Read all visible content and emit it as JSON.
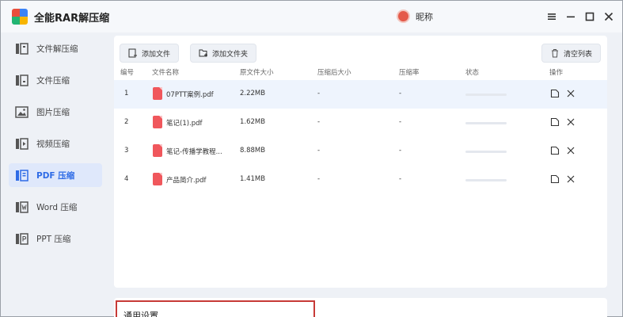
{
  "app": {
    "title": "全能RAR解压缩"
  },
  "user": {
    "name": "昵称"
  },
  "sidebar": {
    "items": [
      {
        "label": "文件解压缩",
        "icon": "archive-extract-icon"
      },
      {
        "label": "文件压缩",
        "icon": "archive-compress-icon"
      },
      {
        "label": "图片压缩",
        "icon": "image-icon"
      },
      {
        "label": "视频压缩",
        "icon": "video-icon"
      },
      {
        "label": "PDF 压缩",
        "icon": "pdf-icon",
        "active": true
      },
      {
        "label": "Word 压缩",
        "icon": "word-icon"
      },
      {
        "label": "PPT 压缩",
        "icon": "ppt-icon"
      }
    ]
  },
  "toolbar": {
    "add_file": "添加文件",
    "add_folder": "添加文件夹",
    "clear_list": "清空列表"
  },
  "table": {
    "headers": {
      "index": "编号",
      "name": "文件名称",
      "orig_size": "原文件大小",
      "comp_size": "压缩后大小",
      "ratio": "压缩率",
      "status": "状态",
      "ops": "操作"
    },
    "rows": [
      {
        "index": "1",
        "name": "07PTT案例.pdf",
        "orig_size": "2.22MB",
        "comp_size": "-",
        "ratio": "-"
      },
      {
        "index": "2",
        "name": "笔记(1).pdf",
        "orig_size": "1.62MB",
        "comp_size": "-",
        "ratio": "-"
      },
      {
        "index": "3",
        "name": "笔记-传播学教程...",
        "orig_size": "8.88MB",
        "comp_size": "-",
        "ratio": "-"
      },
      {
        "index": "4",
        "name": "产品简介.pdf",
        "orig_size": "1.41MB",
        "comp_size": "-",
        "ratio": "-"
      }
    ]
  },
  "settings": {
    "title": "通用设置"
  },
  "colors": {
    "accent": "#2e6be6",
    "pdf": "#f0575c",
    "highlight_border": "#c73a37"
  }
}
